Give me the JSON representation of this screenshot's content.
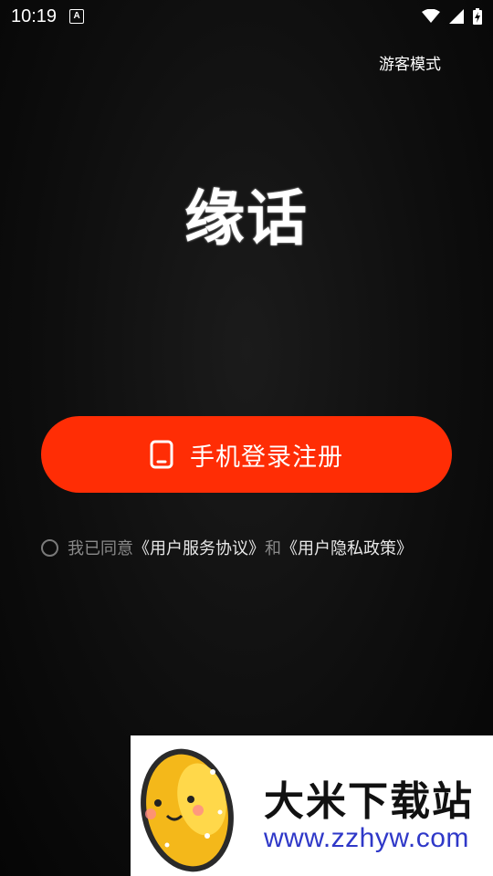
{
  "status_bar": {
    "time": "10:19",
    "notification_icon": "a-icon",
    "wifi_icon": "wifi-icon",
    "signal_icon": "signal-icon",
    "battery_icon": "battery-icon"
  },
  "header": {
    "guest_mode_label": "游客模式"
  },
  "app": {
    "logo_text": "缘话"
  },
  "login": {
    "button_label": "手机登录注册",
    "button_icon": "phone-icon",
    "button_color": "#ff2d05"
  },
  "agreement": {
    "prefix": "我已同意",
    "user_agreement": "《用户服务协议》",
    "conjunction": "和",
    "privacy_policy": "《用户隐私政策》"
  },
  "watermark": {
    "title": "大米下载站",
    "url": "www.zzhyw.com"
  }
}
